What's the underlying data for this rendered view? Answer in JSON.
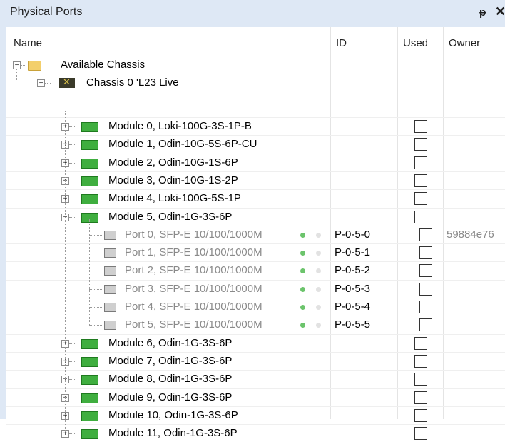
{
  "panel": {
    "title": "Physical Ports",
    "pin_icon": "pin-icon",
    "close_icon": "close-icon"
  },
  "columns": {
    "name": "Name",
    "id": "ID",
    "used": "Used",
    "owner": "Owner"
  },
  "tree": {
    "root_label": "Available Chassis",
    "chassis_label": "Chassis 0 'L23 Live",
    "rows": [
      {
        "kind": "module",
        "label": "Module 0, Loki-100G-3S-1P-B",
        "expanded": false,
        "id": "",
        "owner": ""
      },
      {
        "kind": "module",
        "label": "Module 1, Odin-10G-5S-6P-CU",
        "expanded": false,
        "id": "",
        "owner": ""
      },
      {
        "kind": "module",
        "label": "Module 2, Odin-10G-1S-6P",
        "expanded": false,
        "id": "",
        "owner": ""
      },
      {
        "kind": "module",
        "label": "Module 3, Odin-10G-1S-2P",
        "expanded": false,
        "id": "",
        "owner": ""
      },
      {
        "kind": "module",
        "label": "Module 4, Loki-100G-5S-1P",
        "expanded": false,
        "id": "",
        "owner": ""
      },
      {
        "kind": "module",
        "label": "Module 5, Odin-1G-3S-6P",
        "expanded": true,
        "id": "",
        "owner": ""
      },
      {
        "kind": "port",
        "label": "Port 0, SFP-E 10/100/1000M",
        "id": "P-0-5-0",
        "owner": "59884e76",
        "reserved": true
      },
      {
        "kind": "port",
        "label": "Port 1, SFP-E 10/100/1000M",
        "id": "P-0-5-1",
        "owner": ""
      },
      {
        "kind": "port",
        "label": "Port 2, SFP-E 10/100/1000M",
        "id": "P-0-5-2",
        "owner": ""
      },
      {
        "kind": "port",
        "label": "Port 3, SFP-E 10/100/1000M",
        "id": "P-0-5-3",
        "owner": ""
      },
      {
        "kind": "port",
        "label": "Port 4, SFP-E 10/100/1000M",
        "id": "P-0-5-4",
        "owner": ""
      },
      {
        "kind": "port",
        "label": "Port 5, SFP-E 10/100/1000M",
        "id": "P-0-5-5",
        "owner": ""
      },
      {
        "kind": "module",
        "label": "Module 6, Odin-1G-3S-6P",
        "expanded": false,
        "id": "",
        "owner": ""
      },
      {
        "kind": "module",
        "label": "Module 7, Odin-1G-3S-6P",
        "expanded": false,
        "id": "",
        "owner": ""
      },
      {
        "kind": "module",
        "label": "Module 8, Odin-1G-3S-6P",
        "expanded": false,
        "id": "",
        "owner": ""
      },
      {
        "kind": "module",
        "label": "Module 9, Odin-1G-3S-6P",
        "expanded": false,
        "id": "",
        "owner": ""
      },
      {
        "kind": "module",
        "label": "Module 10, Odin-1G-3S-6P",
        "expanded": false,
        "id": "",
        "owner": ""
      },
      {
        "kind": "module",
        "label": "Module 11, Odin-1G-3S-6P",
        "expanded": false,
        "id": "",
        "owner": ""
      }
    ]
  },
  "icons": {
    "root": "folder-icon",
    "chassis": "chassis-icon",
    "module": "module-icon",
    "port": "port-icon"
  },
  "colors": {
    "title_bar": "#dee8f5",
    "module_icon": "#3fae3f",
    "link_up": "#6cc46c",
    "port_text": "#8a8a8a"
  }
}
